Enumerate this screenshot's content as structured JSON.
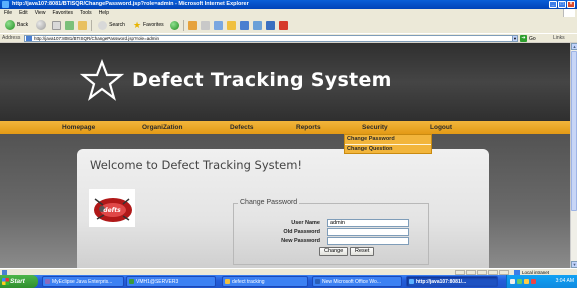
{
  "window": {
    "title": "http://java107:8081/BTISQR/ChangePassword.jsp?role=admin - Microsoft Internet Explorer",
    "controls": [
      "_",
      "□",
      "×"
    ]
  },
  "menubar": [
    "File",
    "Edit",
    "View",
    "Favorites",
    "Tools",
    "Help"
  ],
  "toolbar": {
    "back_label": "Back",
    "search_label": "Search",
    "favorites_label": "Favorites"
  },
  "address": {
    "label": "Address",
    "url": "http://java107:8081/BTISQR/ChangePassword.jsp?role=admin",
    "go_label": "Go",
    "links_label": "Links"
  },
  "site": {
    "title": "Defect Tracking System",
    "nav": [
      "Homepage",
      "OrganiZation",
      "Defects",
      "Reports",
      "Security",
      "Logout"
    ],
    "security_menu": [
      "Change Password",
      "Change Question"
    ],
    "welcome": "Welcome to Defect Tracking System!"
  },
  "form": {
    "legend": "Change Password",
    "user_name_label": "User Name",
    "user_name_value": "admin",
    "old_password_label": "Old Password",
    "old_password_value": "",
    "new_password_label": "New Password",
    "new_password_value": "",
    "change_label": "Change",
    "reset_label": "Reset"
  },
  "statusbar": {
    "zone": "Local intranet"
  },
  "taskbar": {
    "start_label": "Start",
    "tasks": [
      "MyEclipse Java Enterpris...",
      "VMH1@SERVER3",
      "defect tracking",
      "New Microsoft Office Wo...",
      "http://java107:8081/..."
    ],
    "clock": "3:04 AM"
  },
  "colors": {
    "nav_bar": "#f2b53b",
    "header_bg": "#3b3b3b",
    "title_bar": "#0a5fd8"
  }
}
